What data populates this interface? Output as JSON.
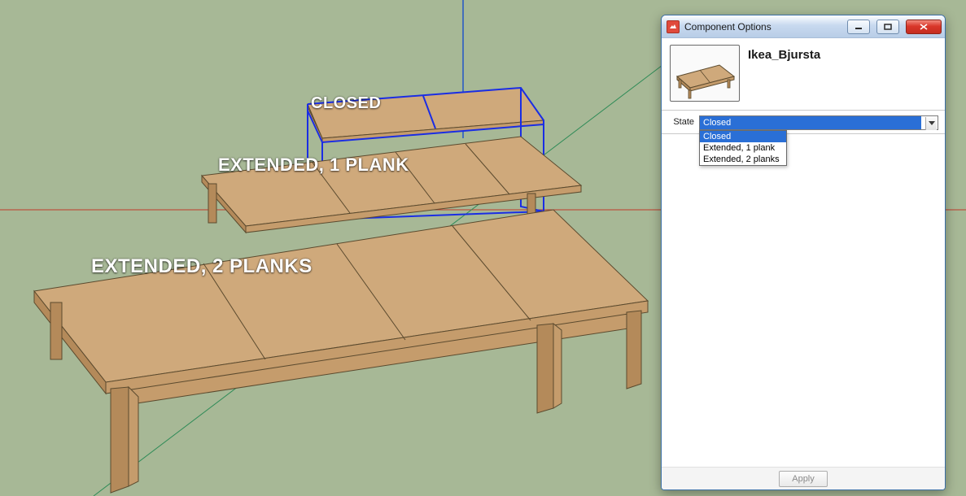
{
  "viewport": {
    "labels": {
      "closed": "CLOSED",
      "ext1": "EXTENDED, 1 PLANK",
      "ext2": "EXTENDED, 2 PLANKS"
    }
  },
  "dialog": {
    "title": "Component Options",
    "component_name": "Ikea_Bjursta",
    "attribute_label": "State",
    "combo": {
      "selected": "Closed",
      "options": [
        "Closed",
        "Extended, 1 plank",
        "Extended, 2 planks"
      ]
    },
    "apply_label": "Apply"
  },
  "icons": {
    "app": "sketchup-icon",
    "minimize": "minimize-icon",
    "maximize": "maximize-icon",
    "close": "close-icon",
    "chevron": "chevron-down-icon"
  },
  "colors": {
    "viewport_bg": "#a7b896",
    "wood": "#cfa97b",
    "selection": "#1a2de4",
    "combo_highlight": "#2a6fd6"
  }
}
